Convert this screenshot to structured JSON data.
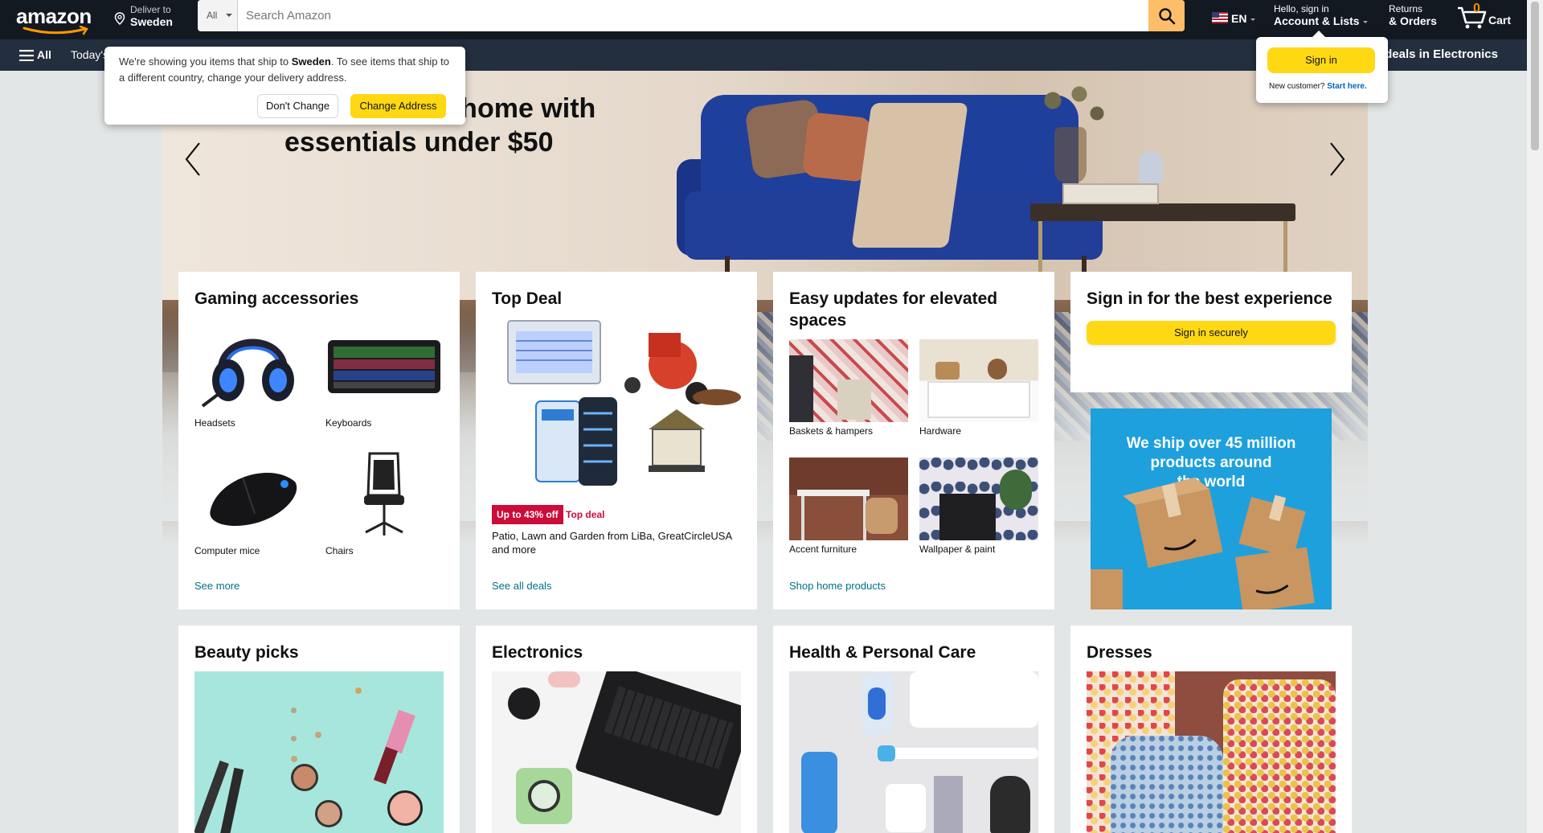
{
  "header": {
    "logo_text": "amazon",
    "deliver_to_label": "Deliver to",
    "deliver_to_location": "Sweden",
    "search_category": "All",
    "search_placeholder": "Search Amazon",
    "language": "EN",
    "account_greeting": "Hello, sign in",
    "account_label": "Account & Lists",
    "returns_label": "Returns",
    "orders_label": "& Orders",
    "cart_count": "0",
    "cart_label": "Cart"
  },
  "subnav": {
    "all_label": "All",
    "today_label": "Today's",
    "promo_label": "op deals in Electronics"
  },
  "ship_popover": {
    "message_pre": "We're showing you items that ship to ",
    "message_country": "Sweden",
    "message_post": ". To see items that ship to a different country, change your delivery address.",
    "dont_change": "Don't Change",
    "change_address": "Change Address"
  },
  "account_popover": {
    "sign_in": "Sign in",
    "new_customer": "New customer?",
    "start_here": "Start here."
  },
  "hero": {
    "headline_line1": "Refresh your home with",
    "headline_line2": "essentials under $50"
  },
  "cards": {
    "gaming": {
      "title": "Gaming accessories",
      "items": [
        "Headsets",
        "Keyboards",
        "Computer mice",
        "Chairs"
      ],
      "link": "See more"
    },
    "top_deal": {
      "title": "Top Deal",
      "badge": "Up to 43% off",
      "badge_label": "Top deal",
      "description": "Patio, Lawn and Garden from LiBa, GreatCircleUSA and more",
      "link": "See all deals"
    },
    "home": {
      "title": "Easy updates for elevated spaces",
      "items": [
        "Baskets & hampers",
        "Hardware",
        "Accent furniture",
        "Wallpaper & paint"
      ],
      "link": "Shop home products"
    },
    "signin": {
      "title": "Sign in for the best experience",
      "button": "Sign in securely"
    },
    "ship_ad": {
      "line1": "We ship over 45 million",
      "line2": "products around",
      "line3": "the world"
    },
    "beauty": {
      "title": "Beauty picks"
    },
    "electronics": {
      "title": "Electronics"
    },
    "health": {
      "title": "Health & Personal Care"
    },
    "dresses": {
      "title": "Dresses"
    }
  },
  "colors": {
    "nav_dark": "#131921",
    "subnav": "#232f3e",
    "search_button": "#febd69",
    "cta_yellow": "#ffd814",
    "deal_red": "#cc0c39",
    "link_teal": "#007185",
    "cart_orange": "#f08804"
  }
}
